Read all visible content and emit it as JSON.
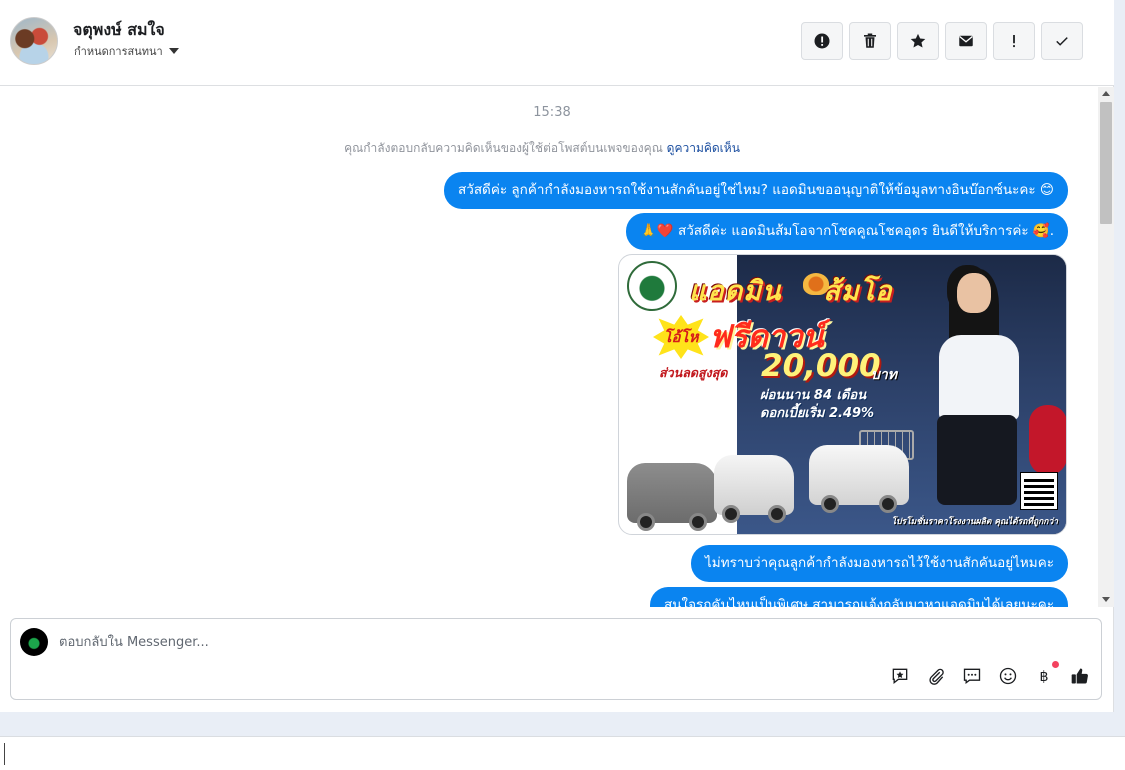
{
  "header": {
    "contact_name": "จตุพงษ์ สมใจ",
    "assign_label": "กำหนดการสนทนา",
    "actions": [
      {
        "name": "spam-button",
        "icon": "alert-circle-icon"
      },
      {
        "name": "delete-button",
        "icon": "trash-icon"
      },
      {
        "name": "star-button",
        "icon": "star-icon"
      },
      {
        "name": "mark-unread-button",
        "icon": "envelope-icon"
      },
      {
        "name": "follow-up-button",
        "icon": "exclamation-icon"
      },
      {
        "name": "mark-done-button",
        "icon": "check-icon"
      }
    ]
  },
  "chat": {
    "timestamp": "15:38",
    "notice_text": "คุณกำลังตอบกลับความคิดเห็นของผู้ใช้ต่อโพสต์บนเพจของคุณ",
    "notice_link": "ดูความคิดเห็น",
    "messages": [
      {
        "text": "สวัสดีค่ะ ลูกค้ากำลังมองหารถใช้งานสักคันอยู่ใช่ไหม? แอดมินขออนุญาติให้ข้อมูลทางอินบ๊อกซ์นะคะ 😊"
      },
      {
        "text": "🙏❤️ สวัสดีค่ะ แอดมินส้มโอจากโชคคูณโชคอุดร ยินดีให้บริการค่ะ 🥰."
      },
      {
        "text": "ไม่ทราบว่าคุณลูกค้ากำลังมองหารถไว้ใช้งานสักคันอยู่ไหมคะ"
      },
      {
        "text": "สนใจรถคันไหนเป็นพิเศษ สามารถแจ้งกลับมาหาแอดมินได้เลยนะคะ"
      }
    ],
    "promo": {
      "title_1": "แอดมิน",
      "title_2": "ส้มโอ",
      "burst": "โอ้โห",
      "headline": "ฟรีดาวน์",
      "discount_label": "ส่วนลดสูงสุด",
      "discount_value": "20,000",
      "discount_unit": "บาท",
      "installment": "ผ่อนนาน 84 เดือน",
      "interest": "ดอกเบี้ยเริ่ม 2.49%",
      "footer": "โปรโมชั่นราคาโรงงานผลิต คุณได้รถที่ถูกกว่า"
    }
  },
  "composer": {
    "placeholder": "ตอบกลับใน Messenger...",
    "tools": [
      "saved-reply-icon",
      "attachment-icon",
      "chat-bubble-icon",
      "emoji-icon",
      "baht-payment-icon",
      "like-icon"
    ]
  }
}
